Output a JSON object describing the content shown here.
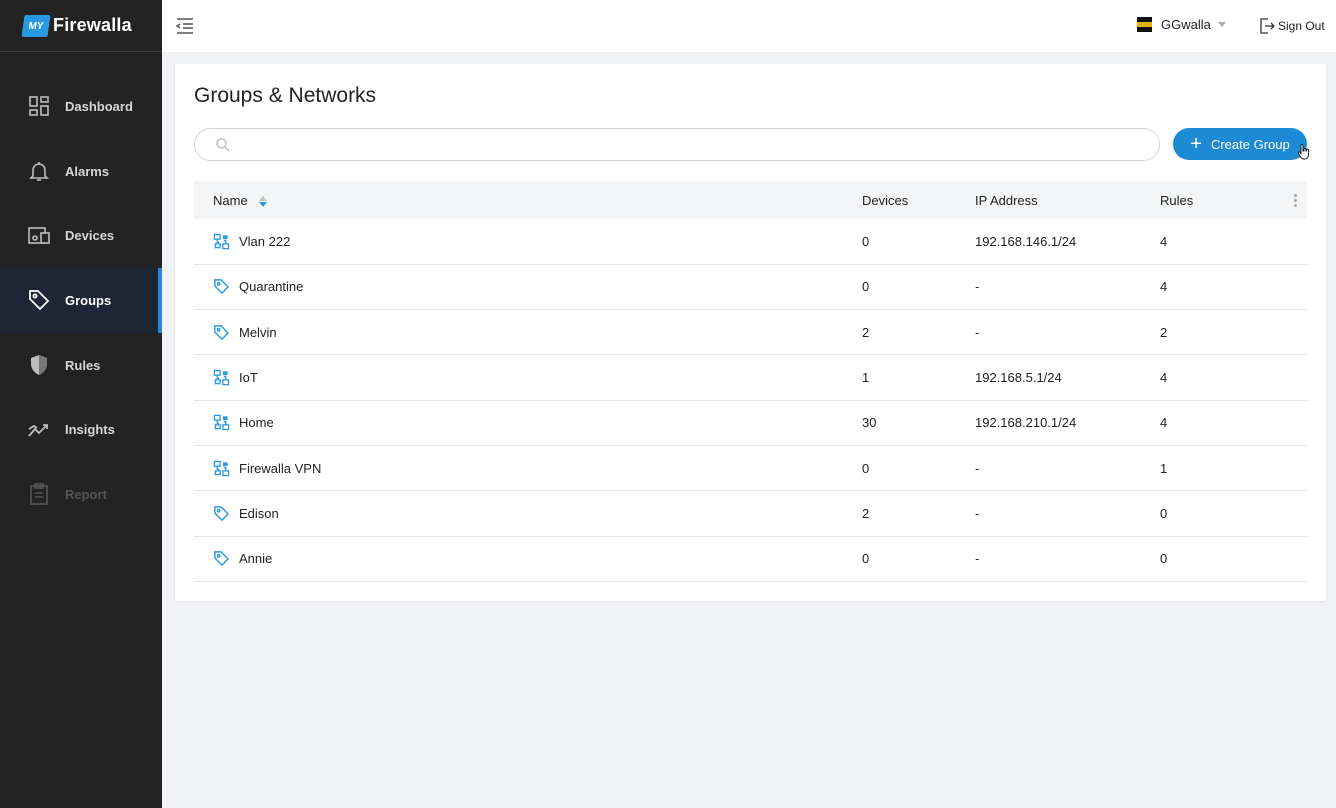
{
  "brand": {
    "badge": "MY",
    "name": "Firewalla"
  },
  "sidebar": {
    "items": [
      {
        "label": "Dashboard",
        "icon": "dashboard-icon"
      },
      {
        "label": "Alarms",
        "icon": "bell-icon"
      },
      {
        "label": "Devices",
        "icon": "devices-icon"
      },
      {
        "label": "Groups",
        "icon": "tag-icon",
        "active": true
      },
      {
        "label": "Rules",
        "icon": "shield-icon"
      },
      {
        "label": "Insights",
        "icon": "trend-icon"
      },
      {
        "label": "Report",
        "icon": "clipboard-icon",
        "disabled": true
      }
    ]
  },
  "topbar": {
    "org_name": "GGwalla",
    "signout_label": "Sign Out"
  },
  "page": {
    "title": "Groups & Networks",
    "search_placeholder": "",
    "create_label": "Create Group"
  },
  "table": {
    "headers": {
      "name": "Name",
      "devices": "Devices",
      "ip": "IP Address",
      "rules": "Rules"
    },
    "rows": [
      {
        "name": "Vlan 222",
        "type": "network",
        "devices": "0",
        "ip": "192.168.146.1/24",
        "rules": "4"
      },
      {
        "name": "Quarantine",
        "type": "group",
        "devices": "0",
        "ip": "-",
        "rules": "4"
      },
      {
        "name": "Melvin",
        "type": "group",
        "devices": "2",
        "ip": "-",
        "rules": "2"
      },
      {
        "name": "IoT",
        "type": "network",
        "devices": "1",
        "ip": "192.168.5.1/24",
        "rules": "4"
      },
      {
        "name": "Home",
        "type": "network",
        "devices": "30",
        "ip": "192.168.210.1/24",
        "rules": "4"
      },
      {
        "name": "Firewalla VPN",
        "type": "network",
        "devices": "0",
        "ip": "-",
        "rules": "1"
      },
      {
        "name": "Edison",
        "type": "group",
        "devices": "2",
        "ip": "-",
        "rules": "0"
      },
      {
        "name": "Annie",
        "type": "group",
        "devices": "0",
        "ip": "-",
        "rules": "0"
      }
    ]
  },
  "colors": {
    "accent": "#1e8ad6",
    "sidebar_bg": "#232323",
    "active_bg": "#1d2637",
    "icon_blue": "#2a9ae0"
  }
}
